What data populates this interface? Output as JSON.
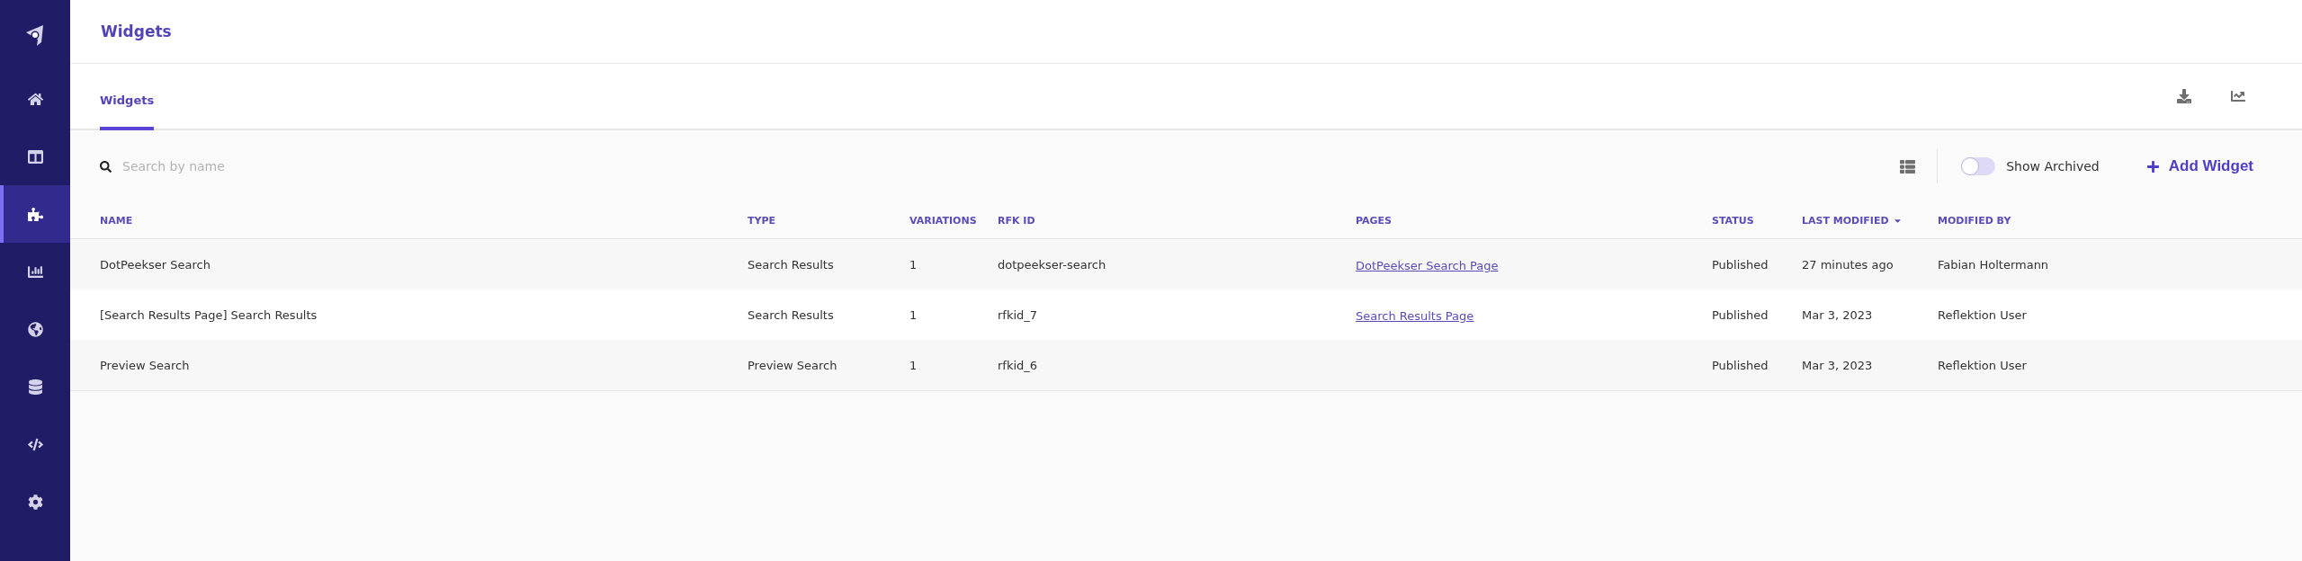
{
  "sidebar": {
    "items": [
      {
        "selected": false
      },
      {
        "selected": false
      },
      {
        "selected": true
      },
      {
        "selected": false
      },
      {
        "selected": false
      },
      {
        "selected": false
      },
      {
        "selected": false
      },
      {
        "selected": false
      }
    ]
  },
  "header": {
    "title": "Widgets"
  },
  "tabs": [
    {
      "label": "Widgets",
      "selected": true
    }
  ],
  "toolbar": {
    "search": {
      "placeholder": "Search by name"
    },
    "show_archived": {
      "label": "Show Archived",
      "on": false
    },
    "add_button": "Add Widget"
  },
  "table": {
    "columns": [
      {
        "label": "NAME",
        "sorted": false
      },
      {
        "label": "TYPE",
        "sorted": false
      },
      {
        "label": "VARIATIONS",
        "sorted": false
      },
      {
        "label": "RFK ID",
        "sorted": false
      },
      {
        "label": "PAGES",
        "sorted": false
      },
      {
        "label": "STATUS",
        "sorted": false
      },
      {
        "label": "LAST MODIFIED",
        "sorted": true
      },
      {
        "label": "MODIFIED BY",
        "sorted": false
      }
    ],
    "rows": [
      {
        "name": "DotPeekser Search",
        "type": "Search Results",
        "variations": "1",
        "rfk_id": "dotpeekser-search",
        "page": "DotPeekser Search Page",
        "status": "Published",
        "last_modified": "27 minutes ago",
        "modified_by": "Fabian Holtermann"
      },
      {
        "name": "[Search Results Page] Search Results",
        "type": "Search Results",
        "variations": "1",
        "rfk_id": "rfkid_7",
        "page": "Search Results Page",
        "status": "Published",
        "last_modified": "Mar 3, 2023",
        "modified_by": "Reflektion User"
      },
      {
        "name": "Preview Search",
        "type": "Preview Search",
        "variations": "1",
        "rfk_id": "rfkid_6",
        "status": "Published",
        "last_modified": "Mar 3, 2023",
        "modified_by": "Reflektion User"
      }
    ]
  }
}
